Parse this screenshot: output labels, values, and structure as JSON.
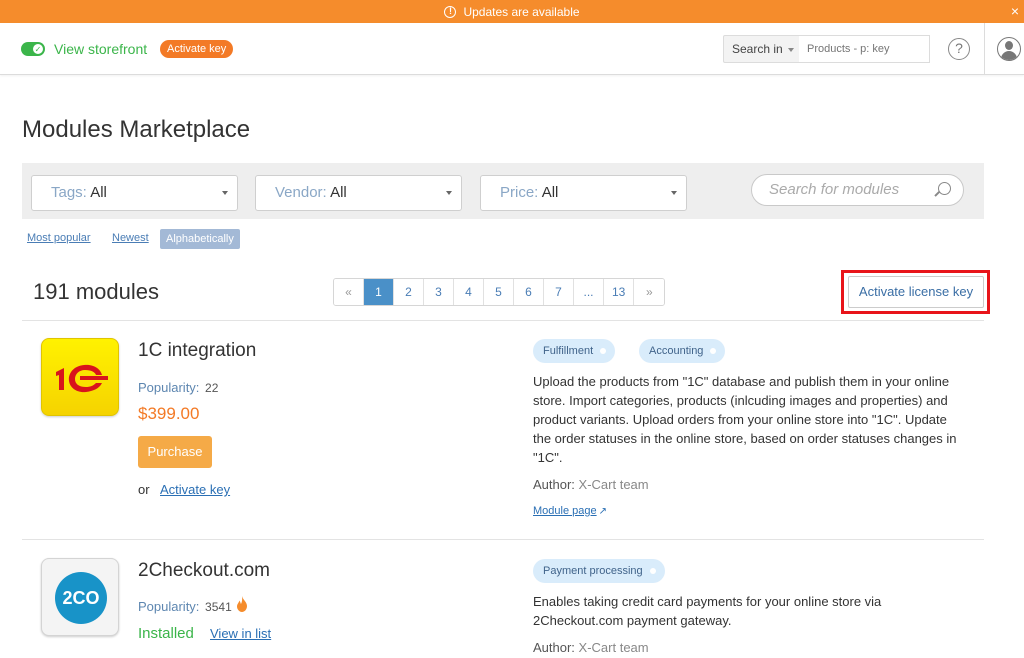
{
  "notification": {
    "text": "Updates are available",
    "close_label": "×"
  },
  "topbar": {
    "view_storefront": "View storefront",
    "activate_key_badge": "Activate key",
    "search_in_label": "Search in",
    "search_placeholder": "Products - p: key",
    "help_label": "?"
  },
  "page": {
    "title": "Modules Marketplace",
    "filters": {
      "tags": {
        "label": "Tags:",
        "value": "All"
      },
      "vendor": {
        "label": "Vendor:",
        "value": "All"
      },
      "price": {
        "label": "Price:",
        "value": "All"
      },
      "search_placeholder": "Search for modules"
    },
    "sort": {
      "most_popular": "Most popular",
      "newest": "Newest",
      "alphabetically": "Alphabetically",
      "active": "Alphabetically"
    },
    "count": "191 modules",
    "pagination": [
      "«",
      "1",
      "2",
      "3",
      "4",
      "5",
      "6",
      "7",
      "...",
      "13",
      "»"
    ],
    "pagination_active": "1",
    "activate_license_key": "Activate license key"
  },
  "modules": [
    {
      "name": "1C integration",
      "icon": "1c-logo-icon",
      "popularity_label": "Popularity:",
      "popularity": "22",
      "price": "$399.00",
      "purchase_label": "Purchase",
      "or_text": "or",
      "activate_key_link": "Activate key",
      "tags": [
        "Fulfillment",
        "Accounting"
      ],
      "description": "Upload the products from \"1C\" database and publish them in your online store. Import categories, products (inlcuding images and properties) and product variants. Upload orders from your online store into \"1C\". Update the order statuses in the online store, based on order statuses changes in \"1C\".",
      "author_label": "Author:",
      "author": "X-Cart team",
      "module_page_link": "Module page"
    },
    {
      "name": "2Checkout.com",
      "icon": "2checkout-logo-icon",
      "icon_text": "2CO",
      "popularity_label": "Popularity:",
      "popularity": "3541",
      "status": "Installed",
      "view_in_list_link": "View in list",
      "tags": [
        "Payment processing"
      ],
      "description": "Enables taking credit card payments for your online store via 2Checkout.com payment gateway.",
      "author_label": "Author:",
      "author": "X-Cart team"
    }
  ],
  "colors": {
    "accent": "#f58c2c",
    "success": "#3bb54a",
    "link": "#2a6fb4",
    "highlight_box": "#e8141a"
  }
}
